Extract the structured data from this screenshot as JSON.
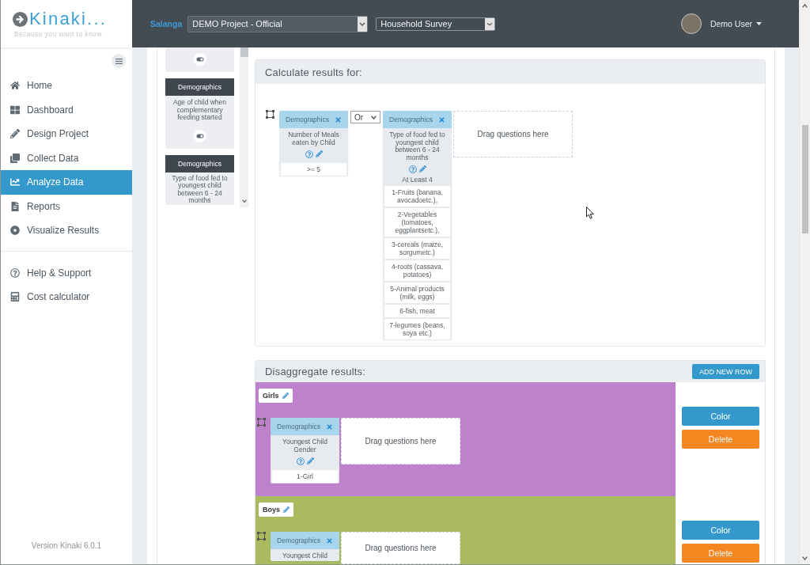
{
  "brand": {
    "name": "Kinaki...",
    "tagline": "Because you want to know"
  },
  "sidebar": {
    "items": [
      {
        "label": "Home",
        "selected": false
      },
      {
        "label": "Dashboard",
        "selected": false
      },
      {
        "label": "Design Project",
        "selected": false
      },
      {
        "label": "Collect Data",
        "selected": false
      },
      {
        "label": "Analyze Data",
        "selected": true
      },
      {
        "label": "Reports",
        "selected": false
      },
      {
        "label": "Visualize Results",
        "selected": false
      }
    ],
    "support_items": [
      {
        "label": "Help & Support",
        "selected": false
      },
      {
        "label": "Cost calculator",
        "selected": false
      }
    ],
    "version": "Version Kinaki 6.0.1"
  },
  "header": {
    "organization": "Salanga",
    "project_select": {
      "value": "DEMO Project - Official"
    },
    "survey_select": {
      "value": "Household Survey"
    },
    "user": {
      "name": "Demo User"
    }
  },
  "question_list": {
    "cards": [
      {
        "kind": "tail"
      },
      {
        "kind": "full",
        "category": "Demographics",
        "question": "Age of child when complementary feeding started"
      },
      {
        "kind": "head",
        "category": "Demographics",
        "question": "Type of food fed to youngest child between 6 - 24 months"
      }
    ]
  },
  "calculate": {
    "title": "Calculate results for:",
    "conditions": [
      {
        "kind": "full",
        "category": "Demographics",
        "question": "Number of Meals eaten by Child",
        "answers": [
          ">= 5"
        ]
      },
      {
        "kind": "full",
        "category": "Demographics",
        "question": "Type of food fed to youngest child between 6 - 24 months",
        "qualifier": "At Least 4",
        "answers": [
          "1-Fruits (banana, avocadoetc.),",
          "2-Vegetables (tomatoes, eggplantsetc.),",
          "3-cereals (maize, sorgumetc.)",
          "4-roots (cassava, potatoes)",
          "5-Animal products (milk, eggs)",
          "6-fish, meat",
          "7-legumes (beans, soya etc.)"
        ]
      }
    ],
    "operator": {
      "value": "Or"
    },
    "drop_hint": "Drag questions here"
  },
  "disaggregate": {
    "title": "Disaggregate results:",
    "add_button": "ADD NEW ROW",
    "rows": [
      {
        "label": "Girls",
        "color": "#bd82cb",
        "conditions": [
          {
            "kind": "full",
            "category": "Demographics",
            "question": "Youngest Child Gender",
            "answers": [
              "1-Girl"
            ]
          }
        ],
        "drop_hint": "Drag questions here",
        "color_button": "Color",
        "delete_button": "Delete"
      },
      {
        "label": "Boys",
        "color": "#aaba5f",
        "conditions": [
          {
            "kind": "cut",
            "category": "Demographics",
            "question": "Youngest Child"
          }
        ],
        "drop_hint": "Drag questions here",
        "color_button": "Color",
        "delete_button": "Delete"
      }
    ]
  }
}
